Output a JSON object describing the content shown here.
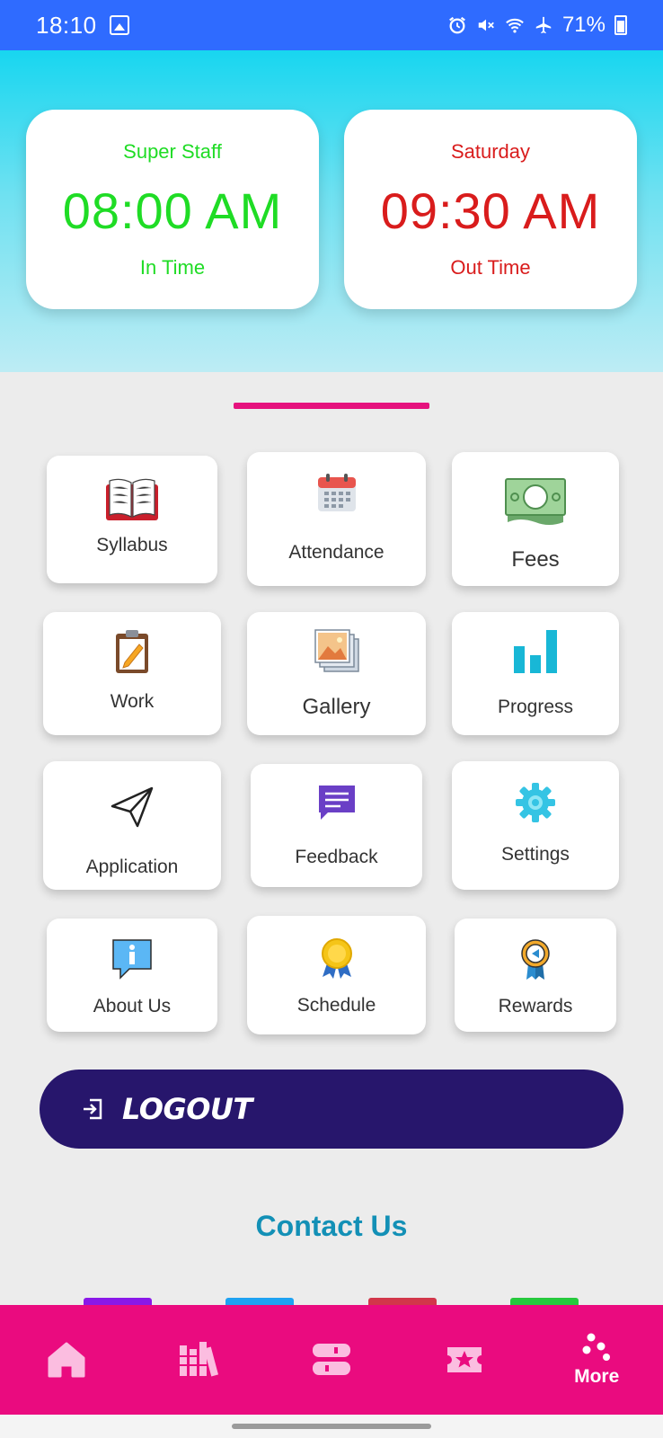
{
  "status_bar": {
    "time": "18:10",
    "battery": "71%"
  },
  "in_card": {
    "title": "Super Staff",
    "time": "08:00 AM",
    "caption": "In Time"
  },
  "out_card": {
    "title": "Saturday",
    "time": "09:30 AM",
    "caption": "Out Time"
  },
  "tiles": [
    {
      "label": "Syllabus",
      "icon": "book-icon"
    },
    {
      "label": "Attendance",
      "icon": "calendar-icon"
    },
    {
      "label": "Fees",
      "icon": "money-icon"
    },
    {
      "label": "Work",
      "icon": "clipboard-icon"
    },
    {
      "label": "Gallery",
      "icon": "gallery-icon"
    },
    {
      "label": "Progress",
      "icon": "bar-chart-icon"
    },
    {
      "label": "Application",
      "icon": "paper-plane-icon"
    },
    {
      "label": "Feedback",
      "icon": "chat-icon"
    },
    {
      "label": "Settings",
      "icon": "gear-icon"
    },
    {
      "label": "About Us",
      "icon": "info-icon"
    },
    {
      "label": "Schedule",
      "icon": "medal-icon"
    },
    {
      "label": "Rewards",
      "icon": "award-icon"
    }
  ],
  "logout": {
    "label": "LOGOUT"
  },
  "contact": {
    "title": "Contact Us"
  },
  "bottom_nav": {
    "more_label": "More"
  },
  "colors": {
    "accent": "#ea0b7f",
    "logout_bg": "#27166c",
    "in_time": "#1fdc25",
    "out_time": "#d91c1c",
    "status_bar": "#2f6bff"
  }
}
